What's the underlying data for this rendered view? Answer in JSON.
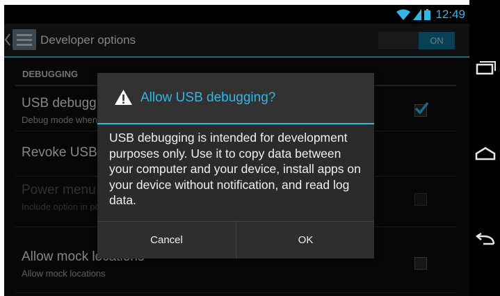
{
  "status_bar": {
    "time": "12:49"
  },
  "action_bar": {
    "title": "Developer options",
    "toggle_label": "ON"
  },
  "list": {
    "section_header": "DEBUGGING",
    "items": [
      {
        "title": "USB debugging",
        "subtitle": "Debug mode when USB is connected",
        "checked": true
      },
      {
        "title": "Revoke USB debugging authorizations",
        "subtitle": ""
      },
      {
        "title": "Power menu bug reports",
        "subtitle": "Include option in power menu for taking a bug report",
        "checked": false,
        "disabled": true
      },
      {
        "title": "Allow mock locations",
        "subtitle": "Allow mock locations",
        "checked": false
      }
    ]
  },
  "dialog": {
    "title": "Allow USB debugging?",
    "message": "USB debugging is intended for development purposes only. Use it to copy data between your computer and your device, install apps on your device without notification, and read log data.",
    "cancel_label": "Cancel",
    "ok_label": "OK"
  },
  "colors": {
    "accent": "#33b5e5",
    "background": "#0d0d0d",
    "dialog": "#2b2b2b"
  },
  "icons": [
    "wifi-icon",
    "signal-icon",
    "battery-icon",
    "up-icon",
    "app-icon",
    "check-icon",
    "warning-icon",
    "recent-apps-icon",
    "home-icon",
    "back-icon"
  ]
}
